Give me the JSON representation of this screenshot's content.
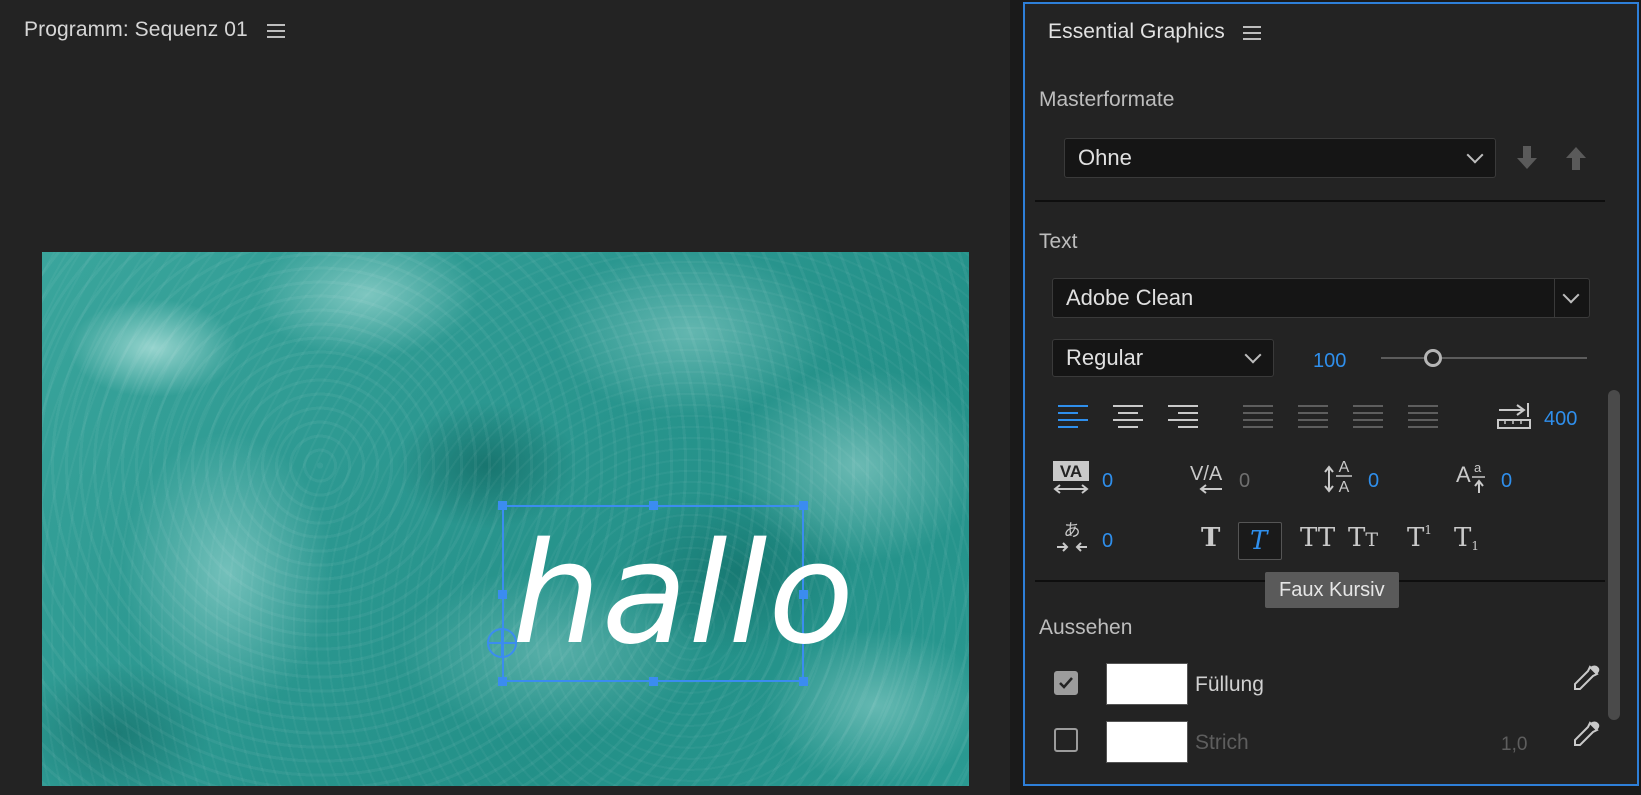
{
  "program_monitor": {
    "title": "Programm: Sequenz 01",
    "menu_icon": "hamburger-menu-icon",
    "overlay_text": "hallo"
  },
  "essential_graphics": {
    "title": "Essential Graphics",
    "menu_icon": "hamburger-menu-icon",
    "masterformate": {
      "label": "Masterformate",
      "selected": "Ohne",
      "icons": [
        "download-arrow-icon",
        "upload-arrow-icon"
      ]
    },
    "text_section": {
      "label": "Text",
      "font": "Adobe Clean",
      "style": "Regular",
      "font_size": "100",
      "font_size_slider": 0.25,
      "tab_width": "400",
      "kerning": "0",
      "tracking": "0",
      "leading": "0",
      "baseline_shift": "0",
      "tsume": "0",
      "alignment_icons": [
        "align-left-icon",
        "align-center-icon",
        "align-right-icon",
        "justify-last-left-icon",
        "justify-last-center-icon",
        "justify-last-right-icon",
        "justify-all-icon"
      ],
      "style_buttons": [
        "faux-bold",
        "faux-italic",
        "all-caps",
        "small-caps",
        "superscript",
        "subscript"
      ]
    },
    "tooltip": "Faux Kursiv",
    "aussehen": {
      "label": "Aussehen",
      "fill": {
        "label": "Füllung",
        "checked": true,
        "color": "#ffffff"
      },
      "stroke": {
        "label": "Strich",
        "checked": false,
        "color": "#ffffff",
        "width": "1,0"
      }
    }
  },
  "colors": {
    "accent": "#2f8fec",
    "panel_bg": "#232323",
    "selection": "#3b8cf0"
  }
}
